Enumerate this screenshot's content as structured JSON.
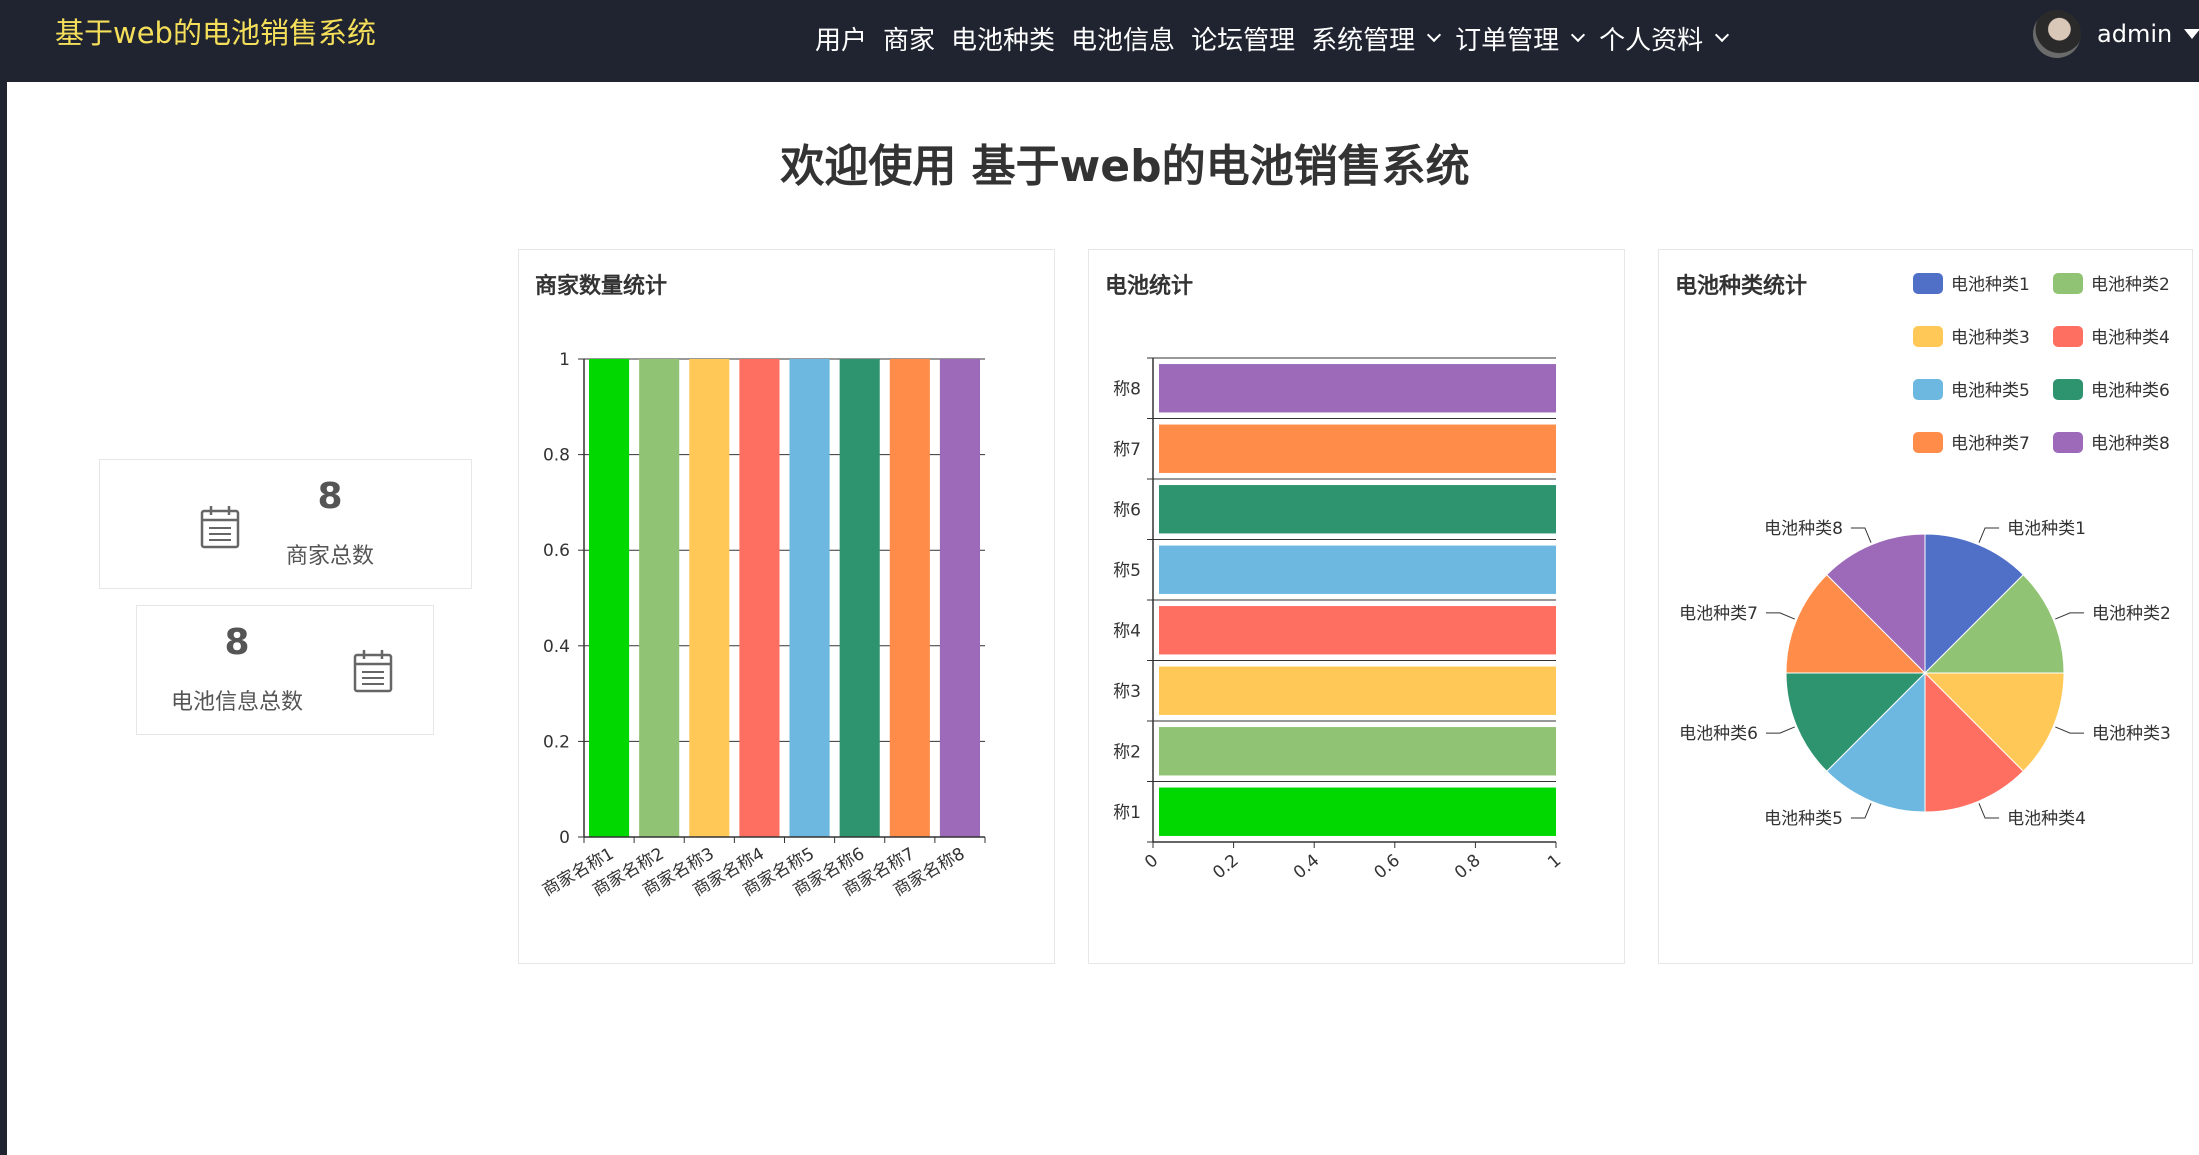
{
  "app": {
    "title": "基于web的电池销售系统"
  },
  "nav": {
    "items": [
      {
        "label": "用户",
        "dropdown": false
      },
      {
        "label": "商家",
        "dropdown": false
      },
      {
        "label": "电池种类",
        "dropdown": false
      },
      {
        "label": "电池信息",
        "dropdown": false
      },
      {
        "label": "论坛管理",
        "dropdown": false
      },
      {
        "label": "系统管理",
        "dropdown": true
      },
      {
        "label": "订单管理",
        "dropdown": true
      },
      {
        "label": "个人资料",
        "dropdown": true
      }
    ]
  },
  "user": {
    "name": "admin"
  },
  "welcome": "欢迎使用 基于web的电池销售系统",
  "stats": {
    "merchants": {
      "value": "8",
      "label": "商家总数",
      "icon": "calendar-icon"
    },
    "batteries": {
      "value": "8",
      "label": "电池信息总数",
      "icon": "calendar-icon"
    }
  },
  "colors": {
    "topbar": "#1f2430",
    "brand": "#f5df5a",
    "palette": [
      "#00d800",
      "#91c374",
      "#ffc857",
      "#ff6f61",
      "#6cb8e0",
      "#2e9470",
      "#ff8c48",
      "#9c6ab8"
    ],
    "pie_palette": [
      "#5070c8",
      "#91c374",
      "#ffc857",
      "#ff6f61",
      "#6cb8e0",
      "#2e9470",
      "#ff8c48",
      "#9c6ab8"
    ]
  },
  "chart_data": [
    {
      "type": "bar",
      "title": "商家数量统计",
      "categories": [
        "商家名称1",
        "商家名称2",
        "商家名称3",
        "商家名称4",
        "商家名称5",
        "商家名称6",
        "商家名称7",
        "商家名称8"
      ],
      "values": [
        1,
        1,
        1,
        1,
        1,
        1,
        1,
        1
      ],
      "yticks": [
        "0",
        "0.2",
        "0.4",
        "0.6",
        "0.8",
        "1"
      ],
      "ylim": [
        0,
        1
      ],
      "grid": true
    },
    {
      "type": "bar",
      "orientation": "horizontal",
      "title": "电池统计",
      "categories": [
        "称1",
        "称2",
        "称3",
        "称4",
        "称5",
        "称6",
        "称7",
        "称8"
      ],
      "values": [
        1,
        1,
        1,
        1,
        1,
        1,
        1,
        1
      ],
      "xticks": [
        "0",
        "0.2",
        "0.4",
        "0.6",
        "0.8",
        "1"
      ],
      "xlim": [
        0,
        1
      ],
      "grid": true
    },
    {
      "type": "pie",
      "title": "电池种类统计",
      "categories": [
        "电池种类1",
        "电池种类2",
        "电池种类3",
        "电池种类4",
        "电池种类5",
        "电池种类6",
        "电池种类7",
        "电池种类8"
      ],
      "values": [
        1,
        1,
        1,
        1,
        1,
        1,
        1,
        1
      ],
      "slice_labels": [
        "电池种类1",
        "电池种类2",
        "电池种类3",
        "电池种类4",
        "电池种类5",
        "电池种类6",
        "电池种类7",
        "电池种类8"
      ],
      "legend": "top-right"
    }
  ]
}
